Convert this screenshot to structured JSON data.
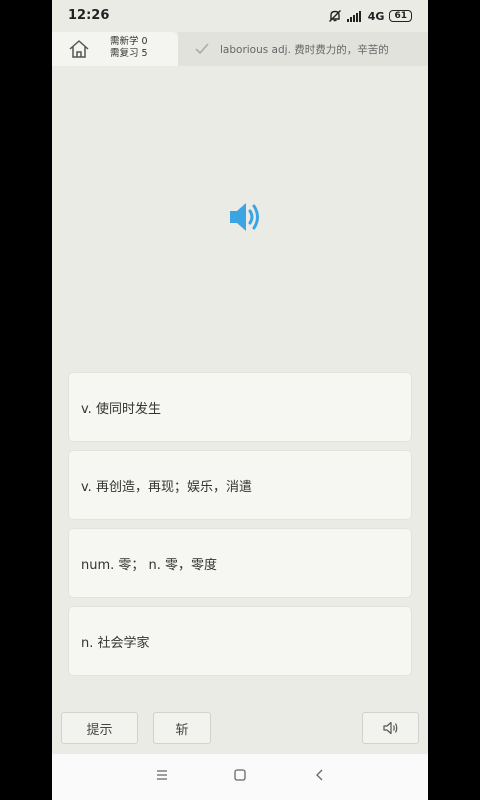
{
  "status": {
    "time": "12:26",
    "network": "4G",
    "battery": "61"
  },
  "header": {
    "new_label": "需新学 0",
    "review_label": "需复习 5",
    "last_word": "laborious adj. 费时费力的，辛苦的"
  },
  "options": [
    "v. 使同时发生",
    "v. 再创造，再现；娱乐，消遣",
    "num. 零；  n. 零，零度",
    "n. 社会学家"
  ],
  "buttons": {
    "hint": "提示",
    "chop": "斩"
  },
  "colors": {
    "accent": "#3da4e3",
    "background": "#ebebe6",
    "card": "#f6f6f3"
  }
}
